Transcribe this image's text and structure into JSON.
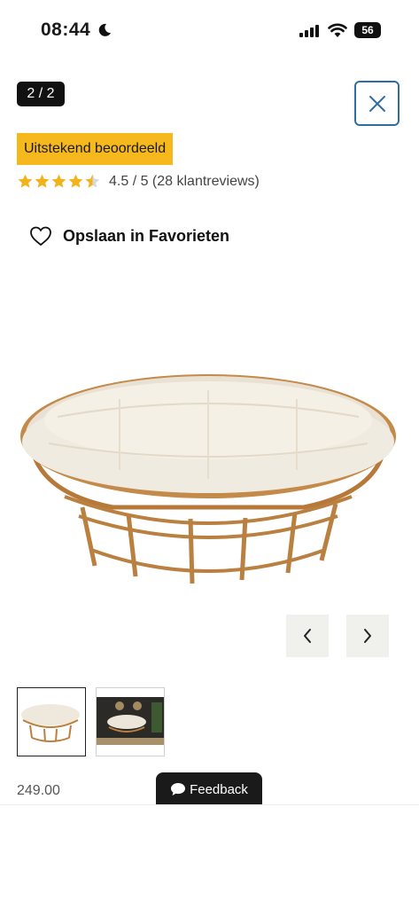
{
  "status_bar": {
    "time": "08:44",
    "battery": "56"
  },
  "gallery": {
    "counter": "2 / 2"
  },
  "rating": {
    "badge": "Uitstekend beoordeeld",
    "stars": 4.5,
    "text": "4.5 / 5 (28 klantreviews)"
  },
  "favorites": {
    "label": "Opslaan in Favorieten"
  },
  "product": {
    "price": "249.00"
  },
  "feedback": {
    "label": "Feedback"
  },
  "colors": {
    "rating_yellow": "#f5b81d",
    "close_border": "#2f6ea1",
    "star": "#f2b21a"
  },
  "icons": [
    "moon-icon",
    "signal-icon",
    "wifi-icon",
    "close-icon",
    "star-icon",
    "heart-icon",
    "chevron-left-icon",
    "chevron-right-icon",
    "chat-bubble-icon"
  ]
}
